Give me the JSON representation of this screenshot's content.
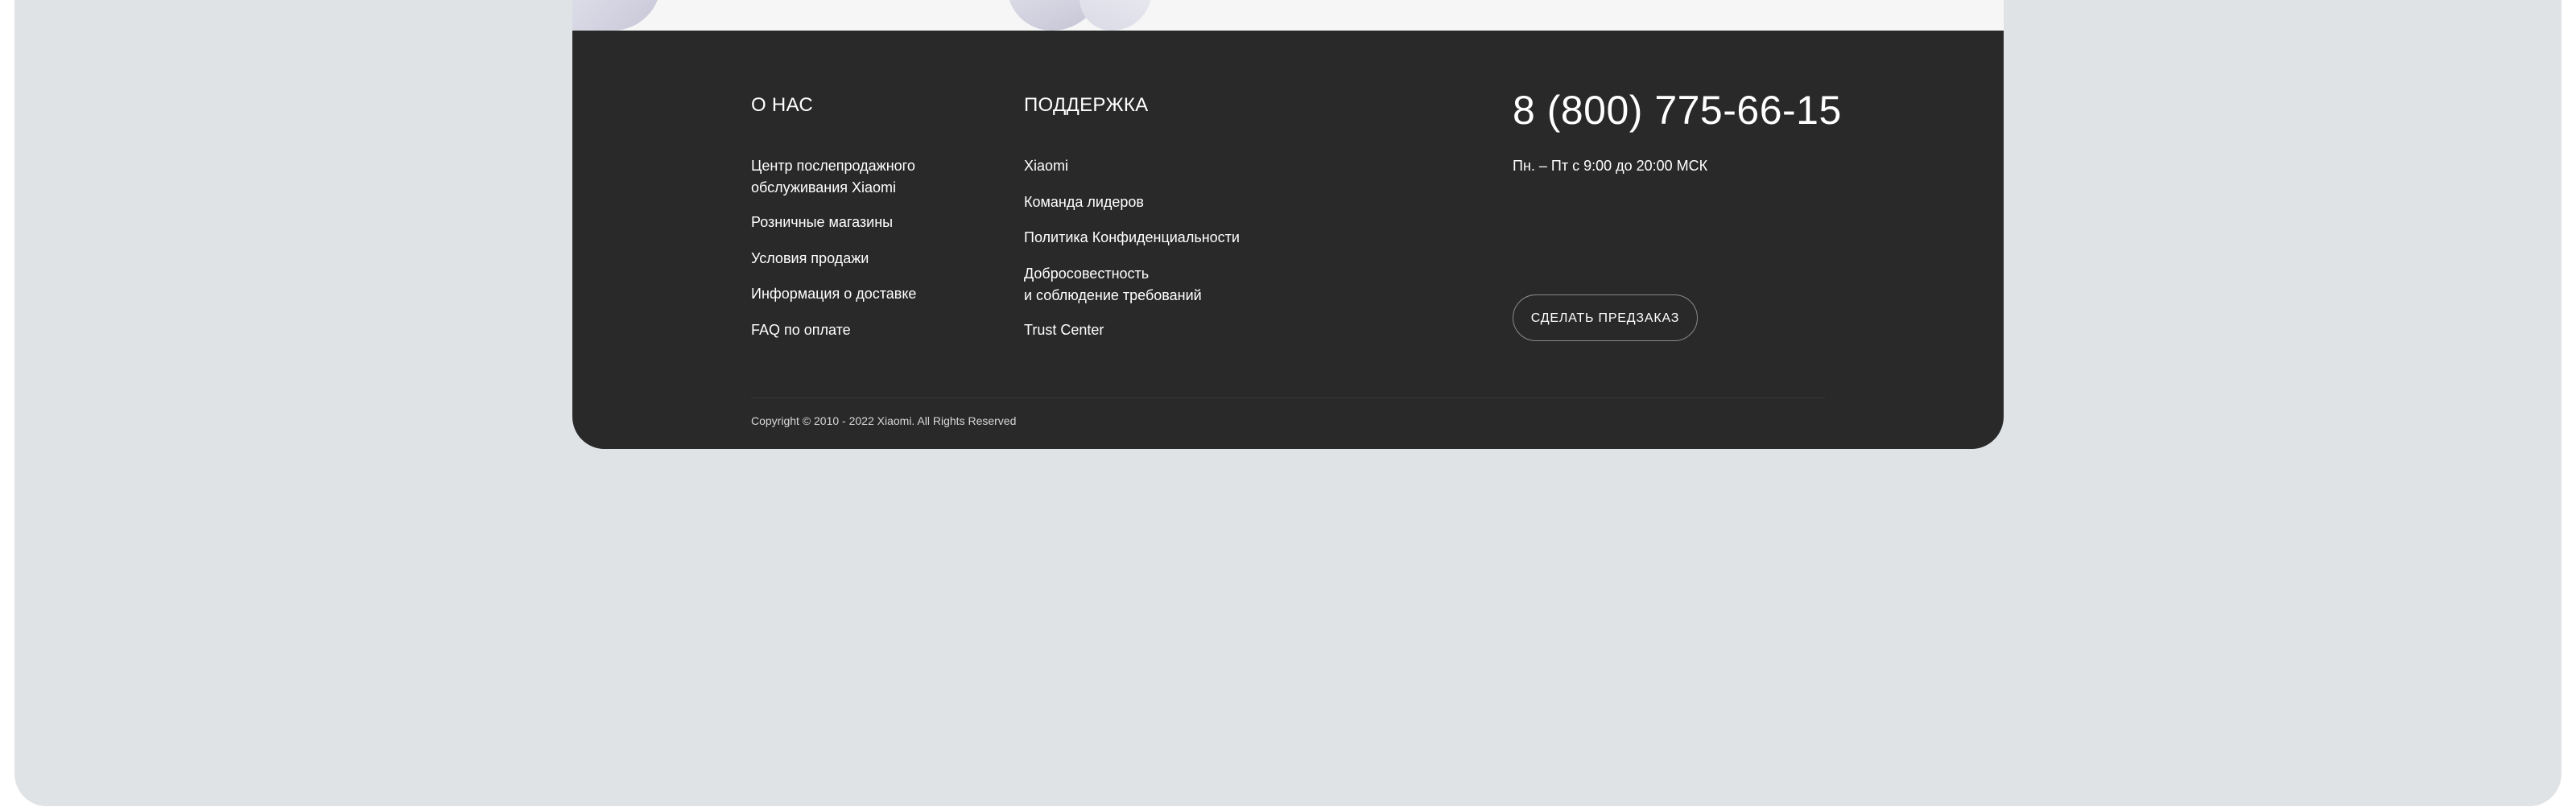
{
  "footer": {
    "about": {
      "heading": "О НАС",
      "links": [
        {
          "line1": "Центр послепродажного",
          "line2": "обслуживания Xiaomi"
        },
        {
          "line1": "Розничные магазины"
        },
        {
          "line1": "Условия продажи"
        },
        {
          "line1": "Информация о доставке"
        },
        {
          "line1": "FAQ по оплате"
        }
      ]
    },
    "support": {
      "heading": "ПОДДЕРЖКА",
      "links": [
        {
          "line1": "Xiaomi"
        },
        {
          "line1": "Команда лидеров"
        },
        {
          "line1": "Политика Конфиденциальности"
        },
        {
          "line1": "Добросовестность",
          "line2": "и соблюдение требований"
        },
        {
          "line1": "Trust Center"
        }
      ]
    },
    "contact": {
      "phone": "8 (800) 775-66-15",
      "hours": "Пн. – Пт с 9:00 до 20:00 МСК",
      "preorder_label": "СДЕЛАТЬ ПРЕДЗАКАЗ"
    },
    "copyright": "Copyright © 2010 - 2022 Xiaomi. All Rights Reserved"
  },
  "colors": {
    "footer_bg": "#292929",
    "page_bg": "#e0e3e6",
    "text": "#ffffff"
  }
}
